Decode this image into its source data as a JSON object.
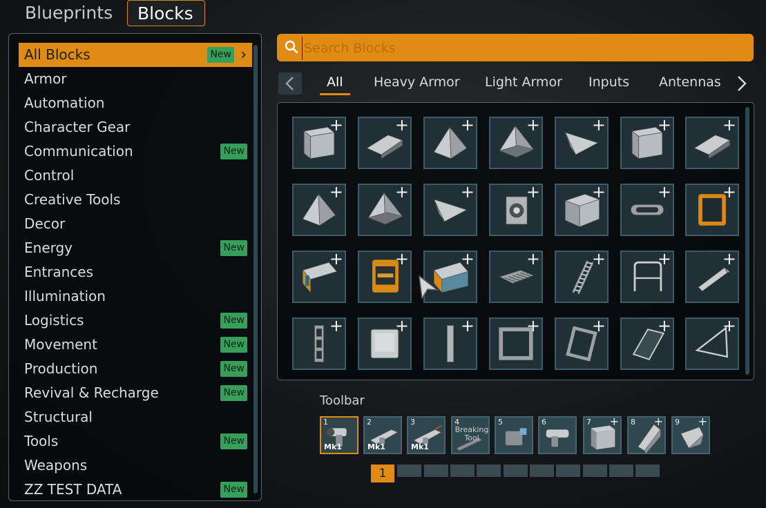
{
  "top_tabs": {
    "blueprints": "Blueprints",
    "blocks": "Blocks"
  },
  "categories": [
    {
      "label": "All Blocks",
      "new": "New",
      "selected": true
    },
    {
      "label": "Armor"
    },
    {
      "label": "Automation"
    },
    {
      "label": "Character Gear"
    },
    {
      "label": "Communication",
      "new": "New"
    },
    {
      "label": "Control"
    },
    {
      "label": "Creative Tools"
    },
    {
      "label": "Decor"
    },
    {
      "label": "Energy",
      "new": "New"
    },
    {
      "label": "Entrances"
    },
    {
      "label": "Illumination"
    },
    {
      "label": "Logistics",
      "new": "New"
    },
    {
      "label": "Movement",
      "new": "New"
    },
    {
      "label": "Production",
      "new": "New"
    },
    {
      "label": "Revival & Recharge",
      "new": "New"
    },
    {
      "label": "Structural"
    },
    {
      "label": "Tools",
      "new": "New"
    },
    {
      "label": "Weapons"
    },
    {
      "label": "ZZ TEST DATA",
      "new": "New"
    }
  ],
  "search": {
    "placeholder": "Search Blocks",
    "value": ""
  },
  "filter_tabs": [
    "All",
    "Heavy Armor",
    "Light Armor",
    "Inputs",
    "Antennas"
  ],
  "active_filter": "All",
  "block_grid": {
    "plus_label": "+",
    "blocks": [
      "armor-cube-icon",
      "armor-slope-icon",
      "armor-corner-icon",
      "armor-pyramid-icon",
      "armor-wedge-icon",
      "armor-cube-icon",
      "armor-slope-icon",
      "armor-corner-icon",
      "armor-pyramid-icon",
      "armor-wedge-icon",
      "camera-icon",
      "rounded-cube-icon",
      "handle-icon",
      "window-frame-icon",
      "corridor-icon",
      "door-panel-icon",
      "corridor-window-icon",
      "vent-grate-icon",
      "ladder-icon",
      "railing-icon",
      "ramp-icon",
      "beam-icon",
      "panel-icon",
      "pillar-icon",
      "frame-square-icon",
      "frame-tilted-icon",
      "glass-panel-icon",
      "triangle-frame-icon"
    ]
  },
  "toolbar": {
    "label": "Toolbar",
    "slots": [
      {
        "num": "1",
        "icon": "drill-tool-icon",
        "mk": "Mk1"
      },
      {
        "num": "2",
        "icon": "welder-tool-icon",
        "mk": "Mk1"
      },
      {
        "num": "3",
        "icon": "grinder-tool-icon",
        "mk": "Mk1"
      },
      {
        "num": "4",
        "icon": "breaking-tool-icon",
        "text": "Breaking Tool"
      },
      {
        "num": "5",
        "icon": "scanner-tool-icon"
      },
      {
        "num": "6",
        "icon": "pistol-tool-icon"
      },
      {
        "num": "7",
        "icon": "armor-cube-icon",
        "plus": "+"
      },
      {
        "num": "8",
        "icon": "armor-slope-icon",
        "plus": "+"
      },
      {
        "num": "9",
        "icon": "armor-corner-icon",
        "plus": "+"
      }
    ]
  },
  "pagination": {
    "current": "1",
    "total_pages": 11
  },
  "colors": {
    "accent": "#e08c14",
    "new_badge": "#35a05c",
    "cell_bg": "#203036",
    "cell_border": "#3c5c66"
  }
}
